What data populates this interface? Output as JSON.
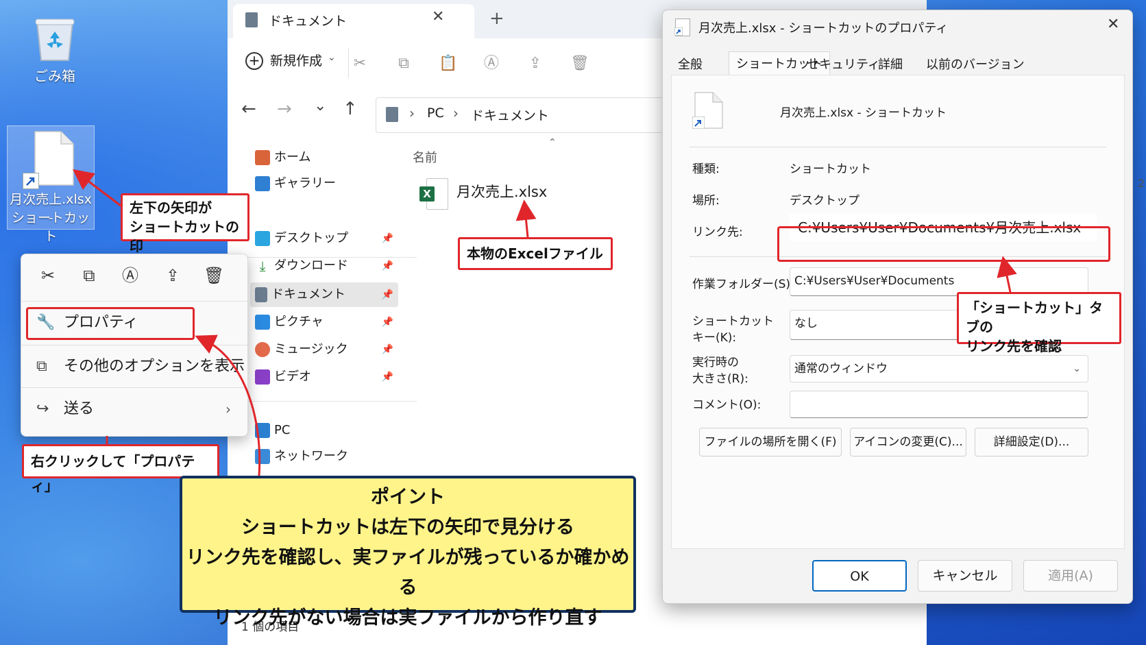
{
  "desktop": {
    "recycle_bin_label": "ごみ箱",
    "shortcut_label_line1": "月次売上.xlsx -",
    "shortcut_label_line2": "ショートカット"
  },
  "explorer": {
    "tab_title": "ドキュメント",
    "new_button": "新規作成",
    "breadcrumb": [
      "PC",
      "ドキュメント"
    ],
    "column_name": "名前",
    "file_name": "月次売上.xlsx",
    "nav_items": [
      {
        "label": "ホーム",
        "icon": "home-icon"
      },
      {
        "label": "ギャラリー",
        "icon": "gallery-icon"
      },
      {
        "label": "デスクトップ",
        "icon": "desktop-icon"
      },
      {
        "label": "ダウンロード",
        "icon": "download-icon"
      },
      {
        "label": "ドキュメント",
        "icon": "document-icon"
      },
      {
        "label": "ピクチャ",
        "icon": "picture-icon"
      },
      {
        "label": "ミュージック",
        "icon": "music-icon"
      },
      {
        "label": "ビデオ",
        "icon": "video-icon"
      },
      {
        "label": "PC",
        "icon": "pc-icon"
      },
      {
        "label": "ネットワーク",
        "icon": "network-icon"
      }
    ],
    "status": "1 個の項目",
    "edge_digit": "2"
  },
  "context_menu": {
    "properties": "プロパティ",
    "more_options": "その他のオプションを表示",
    "send_to": "送る"
  },
  "dialog": {
    "title": "月次売上.xlsx - ショートカットのプロパティ",
    "tabs": [
      "全般",
      "ショートカット",
      "セキュリティ",
      "詳細",
      "以前のバージョン"
    ],
    "file_name": "月次売上.xlsx - ショートカット",
    "type_label": "種類:",
    "type_value": "ショートカット",
    "location_label": "場所:",
    "location_value": "デスクトップ",
    "target_label": "リンク先:",
    "target_value": "C:¥Users¥User¥Documents¥月次売上.xlsx",
    "workdir_label": "作業フォルダー(S):",
    "workdir_value": "C:¥Users¥User¥Documents",
    "hotkey_label_1": "ショートカット",
    "hotkey_label_2": "キー(K):",
    "hotkey_value": "なし",
    "run_label_1": "実行時の",
    "run_label_2": "大きさ(R):",
    "run_value": "通常のウィンドウ",
    "comment_label": "コメント(O):",
    "comment_value": "",
    "btn_open_location": "ファイルの場所を開く(F)",
    "btn_change_icon": "アイコンの変更(C)...",
    "btn_advanced": "詳細設定(D)...",
    "btn_ok": "OK",
    "btn_cancel": "キャンセル",
    "btn_apply": "適用(A)"
  },
  "annotations": {
    "arrow_mark_1": "左下の矢印が",
    "arrow_mark_2": "ショートカットの印",
    "real_file": "本物のExcelファイル",
    "right_click": "右クリックして「プロパティ」",
    "check_link_1": "「ショートカット」タブの",
    "check_link_2": "リンク先を確認",
    "point_title": "ポイント",
    "point_lines": [
      "ショートカットは左下の矢印で見分ける",
      "リンク先を確認し、実ファイルが残っているか確かめる",
      "リンク先がない場合は実ファイルから作り直す"
    ]
  },
  "colors": {
    "accent_red": "#e0262b",
    "point_bg": "#fff48a",
    "point_border": "#10305f",
    "windows_blue": "#0067c0",
    "excel_green": "#1d7044"
  }
}
